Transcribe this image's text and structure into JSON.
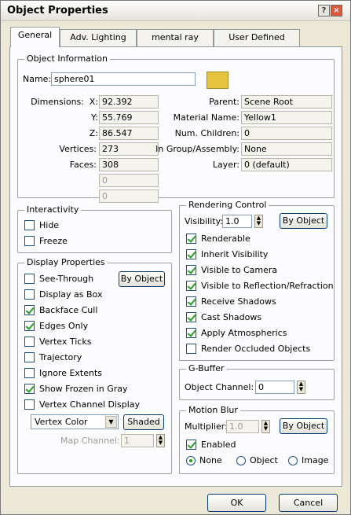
{
  "window": {
    "title": "Object Properties",
    "help_glyph": "?",
    "close_glyph": "×"
  },
  "tabs": [
    "General",
    "Adv. Lighting",
    "mental ray",
    "User Defined"
  ],
  "object_info": {
    "legend": "Object Information",
    "name_label": "Name:",
    "name_value": "sphere01",
    "color": "#e6c43f",
    "dimensions_label": "Dimensions:",
    "x_label": "X:",
    "x_value": "92.392",
    "y_label": "Y:",
    "y_value": "55.769",
    "z_label": "Z:",
    "z_value": "86.547",
    "vertices_label": "Vertices:",
    "vertices_value": "273",
    "faces_label": "Faces:",
    "faces_value": "308",
    "extra1_value": "0",
    "extra2_value": "0",
    "parent_label": "Parent:",
    "parent_value": "Scene Root",
    "material_label": "Material Name:",
    "material_value": "Yellow1",
    "children_label": "Num. Children:",
    "children_value": "0",
    "group_label": "In Group/Assembly:",
    "group_value": "None",
    "layer_label": "Layer:",
    "layer_value": "0 (default)"
  },
  "interactivity": {
    "legend": "Interactivity",
    "hide": {
      "label": "Hide",
      "checked": false
    },
    "freeze": {
      "label": "Freeze",
      "checked": false
    }
  },
  "display": {
    "legend": "Display Properties",
    "by_object": "By Object",
    "items": [
      {
        "label": "See-Through",
        "checked": false
      },
      {
        "label": "Display as Box",
        "checked": false
      },
      {
        "label": "Backface Cull",
        "checked": true
      },
      {
        "label": "Edges Only",
        "checked": true
      },
      {
        "label": "Vertex Ticks",
        "checked": false
      },
      {
        "label": "Trajectory",
        "checked": false
      },
      {
        "label": "Ignore Extents",
        "checked": false
      },
      {
        "label": "Show Frozen in Gray",
        "checked": true
      },
      {
        "label": "Vertex Channel Display",
        "checked": false
      }
    ],
    "vertex_select": "Vertex Color",
    "shaded": "Shaded",
    "map_channel_label": "Map Channel:",
    "map_channel_value": "1"
  },
  "rendering": {
    "legend": "Rendering Control",
    "visibility_label": "Visibility:",
    "visibility_value": "1.0",
    "by_object": "By Object",
    "items": [
      {
        "label": "Renderable",
        "checked": true
      },
      {
        "label": "Inherit Visibility",
        "checked": true
      },
      {
        "label": "Visible to Camera",
        "checked": true
      },
      {
        "label": "Visible to Reflection/Refraction",
        "checked": true
      },
      {
        "label": "Receive Shadows",
        "checked": true
      },
      {
        "label": "Cast Shadows",
        "checked": true
      },
      {
        "label": "Apply Atmospherics",
        "checked": true
      },
      {
        "label": "Render Occluded Objects",
        "checked": false
      }
    ]
  },
  "gbuffer": {
    "legend": "G-Buffer",
    "channel_label": "Object Channel:",
    "channel_value": "0"
  },
  "motion_blur": {
    "legend": "Motion Blur",
    "multiplier_label": "Multiplier:",
    "multiplier_value": "1.0",
    "by_object": "By Object",
    "enabled": {
      "label": "Enabled",
      "checked": true
    },
    "radios": [
      {
        "label": "None",
        "selected": true
      },
      {
        "label": "Object",
        "selected": false
      },
      {
        "label": "Image",
        "selected": false
      }
    ]
  },
  "footer": {
    "ok": "OK",
    "cancel": "Cancel"
  }
}
